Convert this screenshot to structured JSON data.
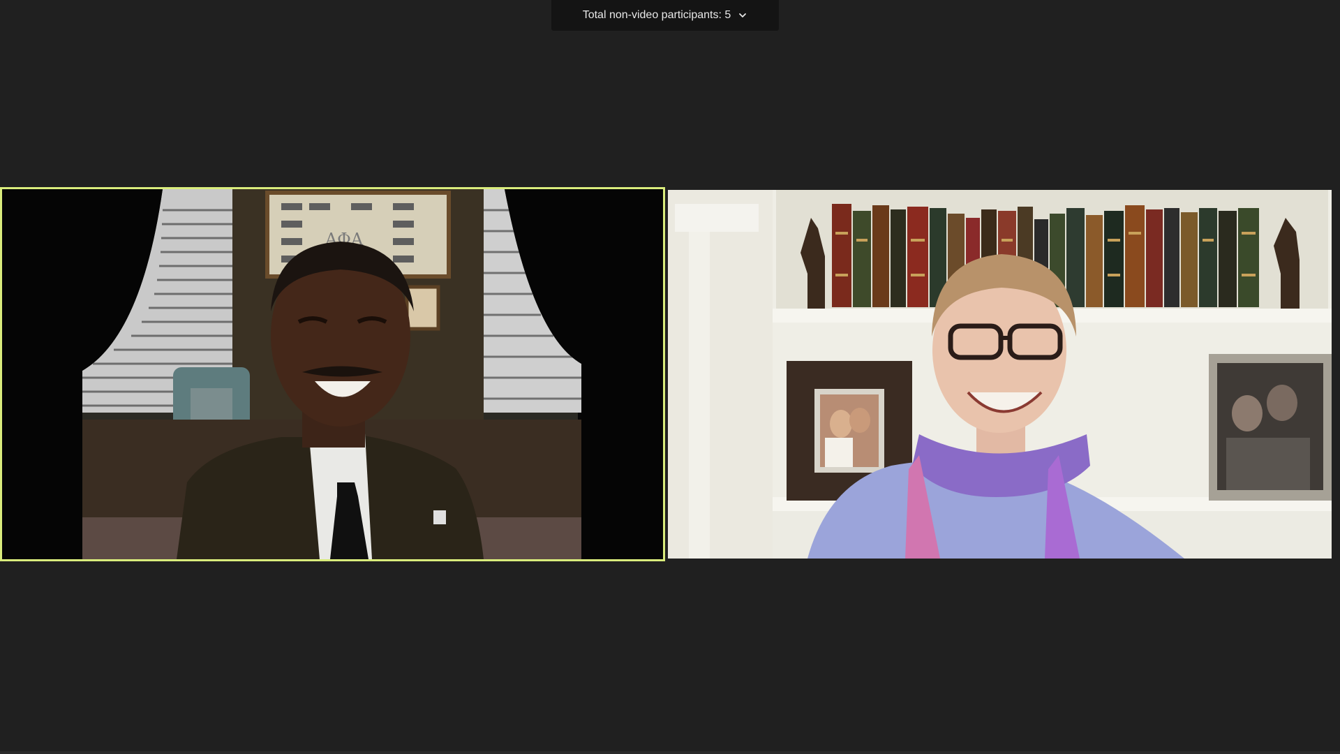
{
  "meeting": {
    "participants_label": "Total non-video participants: 5",
    "participants_dropdown_icon": "chevron-down-icon"
  },
  "tiles": [
    {
      "id": "left",
      "active_speaker": true,
      "highlight_color": "#d9ec7c",
      "description": "participant-video-man"
    },
    {
      "id": "right",
      "active_speaker": false,
      "description": "participant-video-woman"
    }
  ],
  "colors": {
    "background": "#202020",
    "bar_background": "#141414",
    "active_speaker_border": "#d9ec7c"
  }
}
